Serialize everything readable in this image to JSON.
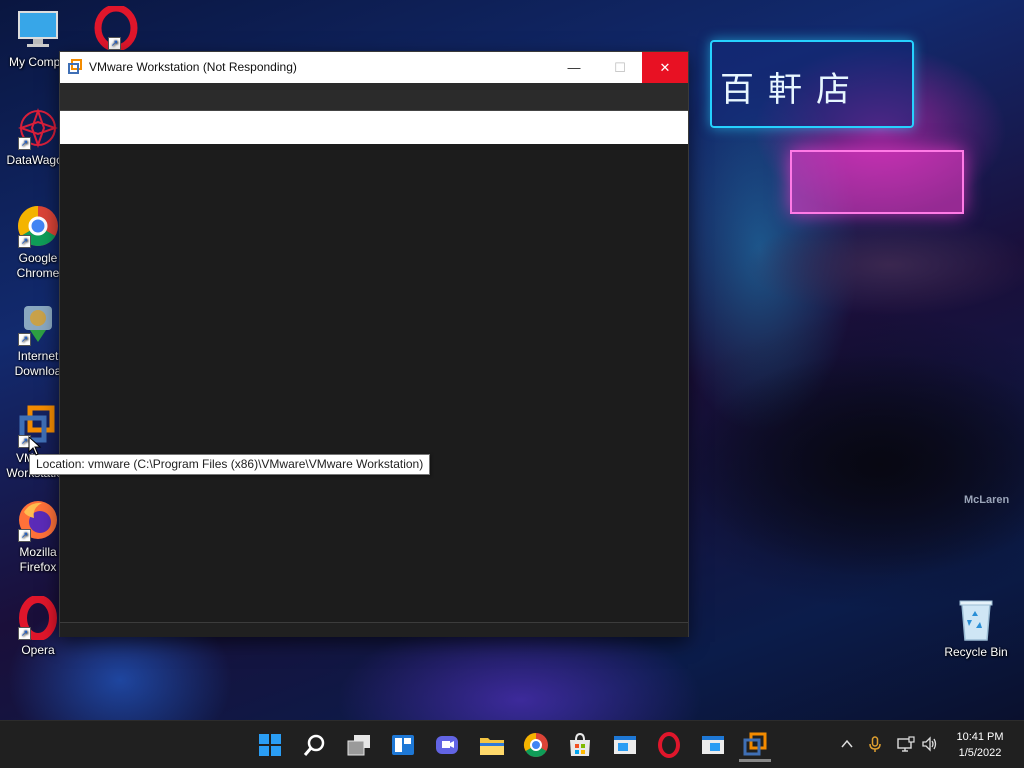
{
  "desktop": {
    "icons": [
      {
        "label": "My Compu"
      },
      {
        "label": "DataWagon"
      },
      {
        "label": "Google Chrome"
      },
      {
        "label": "Internet Downloa"
      },
      {
        "label": "VMware Workstation"
      },
      {
        "label": "Mozilla Firefox"
      },
      {
        "label": "Opera"
      }
    ],
    "recycle_bin": "Recycle Bin",
    "wallpaper_text": "McLaren",
    "sign_text": "百軒店"
  },
  "window": {
    "title": "VMware Workstation (Not Responding)",
    "minimize": "—",
    "maximize": "☐",
    "close": "✕"
  },
  "tooltip": {
    "text": "Location: vmware (C:\\Program Files (x86)\\VMware\\VMware Workstation)"
  },
  "taskbar": {
    "time": "10:41 PM",
    "date": "1/5/2022"
  },
  "colors": {
    "close_red": "#e81123",
    "taskbar_bg": "#202020"
  }
}
